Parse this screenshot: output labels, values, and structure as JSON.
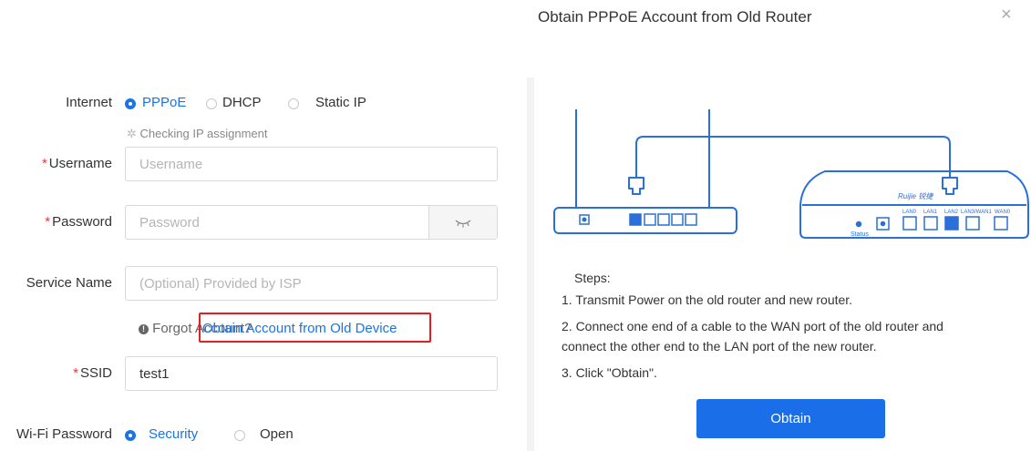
{
  "dialog": {
    "title": "Obtain PPPoE Account from Old Router",
    "close_icon": "close-icon"
  },
  "form": {
    "internet": {
      "label": "Internet",
      "options": [
        "PPPoE",
        "DHCP",
        "Static IP"
      ],
      "selected": "PPPoE",
      "status_text": "Checking IP assignment"
    },
    "username": {
      "label": "Username",
      "placeholder": "Username",
      "value": ""
    },
    "password": {
      "label": "Password",
      "placeholder": "Password",
      "value": "",
      "toggle_icon": "eye-closed-icon"
    },
    "service_name": {
      "label": "Service Name",
      "placeholder": "(Optional) Provided by ISP",
      "value": ""
    },
    "forgot": {
      "text": "Forgot Account?",
      "link": "Obtain Account from Old Device"
    },
    "ssid": {
      "label": "SSID",
      "value": "test1"
    },
    "wifi_password": {
      "label": "Wi-Fi Password",
      "options": [
        "Security",
        "Open"
      ],
      "selected": "Security"
    }
  },
  "diagram": {
    "brand": "Ruijie 锐捷",
    "status_label": "Status",
    "port_labels": [
      "LAN0",
      "LAN1",
      "LAN2",
      "LAN3/WAN1",
      "WAN0"
    ]
  },
  "steps": {
    "heading": "Steps:",
    "items": [
      "1. Transmit Power on the old router and new router.",
      "2. Connect one end of a cable to the WAN port of the old router and",
      "connect the other end to the LAN port of the new router.",
      "3. Click \"Obtain\"."
    ]
  },
  "obtain_button": "Obtain",
  "colors": {
    "accent": "#1a73e8",
    "required": "#e4393c",
    "highlight_box": "#e02020",
    "button": "#1a6ee8"
  }
}
